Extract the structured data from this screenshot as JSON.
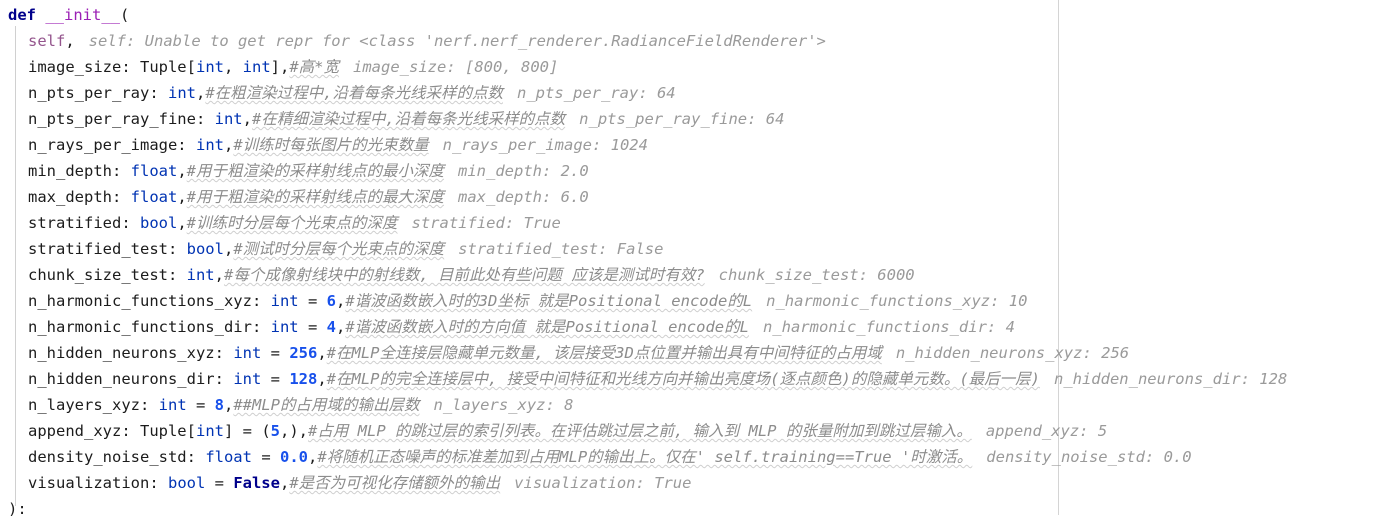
{
  "editor": {
    "language": "python",
    "colors": {
      "background": "#ffffff",
      "keyword": "#00008b",
      "function": "#9b20b5",
      "self": "#94558d",
      "type": "#0033b3",
      "number": "#1750eb",
      "comment": "#8c8c8c",
      "inline_hint": "#9a9a9a",
      "indent_guide": "#d0d0d0",
      "margin_guide": "#d4d4d4",
      "spellcheck_wave": "#cfcfcf"
    }
  },
  "code": {
    "lines": [
      {
        "id": "line-def",
        "indent": 0,
        "tokens": [
          {
            "type": "kw",
            "text": "def"
          },
          {
            "type": "plain",
            "text": " "
          },
          {
            "type": "fn",
            "text": "__init__"
          },
          {
            "type": "punct",
            "text": "("
          }
        ],
        "comment": "",
        "hint": ""
      },
      {
        "id": "line-self",
        "indent": 1,
        "tokens": [
          {
            "type": "self",
            "text": "self"
          },
          {
            "type": "punct",
            "text": ","
          }
        ],
        "comment": "",
        "hint": "self: Unable to get repr for <class 'nerf.nerf_renderer.RadianceFieldRenderer'>"
      },
      {
        "id": "line-image-size",
        "indent": 1,
        "tokens": [
          {
            "type": "plain",
            "text": "image_size: "
          },
          {
            "type": "plain",
            "text": "Tuple"
          },
          {
            "type": "punct",
            "text": "["
          },
          {
            "type": "type",
            "text": "int"
          },
          {
            "type": "punct",
            "text": ", "
          },
          {
            "type": "type",
            "text": "int"
          },
          {
            "type": "punct",
            "text": "],"
          }
        ],
        "comment": "#高*宽",
        "hint": "image_size: [800, 800]"
      },
      {
        "id": "line-n-pts-per-ray",
        "indent": 1,
        "tokens": [
          {
            "type": "plain",
            "text": "n_pts_per_ray: "
          },
          {
            "type": "type",
            "text": "int"
          },
          {
            "type": "punct",
            "text": ","
          }
        ],
        "comment": "#在粗渲染过程中,沿着每条光线采样的点数",
        "hint": "n_pts_per_ray: 64"
      },
      {
        "id": "line-n-pts-per-ray-fine",
        "indent": 1,
        "tokens": [
          {
            "type": "plain",
            "text": "n_pts_per_ray_fine: "
          },
          {
            "type": "type",
            "text": "int"
          },
          {
            "type": "punct",
            "text": ","
          }
        ],
        "comment": "#在精细渲染过程中,沿着每条光线采样的点数",
        "hint": "n_pts_per_ray_fine: 64"
      },
      {
        "id": "line-n-rays-per-image",
        "indent": 1,
        "tokens": [
          {
            "type": "plain",
            "text": "n_rays_per_image: "
          },
          {
            "type": "type",
            "text": "int"
          },
          {
            "type": "punct",
            "text": ","
          }
        ],
        "comment": "#训练时每张图片的光束数量",
        "hint": "n_rays_per_image: 1024"
      },
      {
        "id": "line-min-depth",
        "indent": 1,
        "tokens": [
          {
            "type": "plain",
            "text": "min_depth: "
          },
          {
            "type": "type",
            "text": "float"
          },
          {
            "type": "punct",
            "text": ","
          }
        ],
        "comment": "#用于粗渲染的采样射线点的最小深度",
        "hint": "min_depth: 2.0"
      },
      {
        "id": "line-max-depth",
        "indent": 1,
        "tokens": [
          {
            "type": "plain",
            "text": "max_depth: "
          },
          {
            "type": "type",
            "text": "float"
          },
          {
            "type": "punct",
            "text": ","
          }
        ],
        "comment": "#用于粗渲染的采样射线点的最大深度",
        "hint": "max_depth: 6.0"
      },
      {
        "id": "line-stratified",
        "indent": 1,
        "tokens": [
          {
            "type": "plain",
            "text": "stratified: "
          },
          {
            "type": "type",
            "text": "bool"
          },
          {
            "type": "punct",
            "text": ","
          }
        ],
        "comment": "#训练时分层每个光束点的深度",
        "hint": "stratified: True"
      },
      {
        "id": "line-stratified-test",
        "indent": 1,
        "tokens": [
          {
            "type": "plain",
            "text": "stratified_test: "
          },
          {
            "type": "type",
            "text": "bool"
          },
          {
            "type": "punct",
            "text": ","
          }
        ],
        "comment": "#测试时分层每个光束点的深度",
        "hint": "stratified_test: False"
      },
      {
        "id": "line-chunk-size-test",
        "indent": 1,
        "tokens": [
          {
            "type": "plain",
            "text": "chunk_size_test: "
          },
          {
            "type": "type",
            "text": "int"
          },
          {
            "type": "punct",
            "text": ","
          }
        ],
        "comment": "#每个成像射线块中的射线数, 目前此处有些问题 应该是测试时有效?",
        "hint": "chunk_size_test: 6000"
      },
      {
        "id": "line-n-harmonic-xyz",
        "indent": 1,
        "tokens": [
          {
            "type": "plain",
            "text": "n_harmonic_functions_xyz: "
          },
          {
            "type": "type",
            "text": "int"
          },
          {
            "type": "punct",
            "text": " = "
          },
          {
            "type": "num",
            "text": "6"
          },
          {
            "type": "punct",
            "text": ","
          }
        ],
        "comment": "#谐波函数嵌入时的3D坐标 就是Positional encode的L",
        "hint": "n_harmonic_functions_xyz: 10"
      },
      {
        "id": "line-n-harmonic-dir",
        "indent": 1,
        "tokens": [
          {
            "type": "plain",
            "text": "n_harmonic_functions_dir: "
          },
          {
            "type": "type",
            "text": "int"
          },
          {
            "type": "punct",
            "text": " = "
          },
          {
            "type": "num",
            "text": "4"
          },
          {
            "type": "punct",
            "text": ","
          }
        ],
        "comment": "#谐波函数嵌入时的方向值 就是Positional encode的L",
        "hint": "n_harmonic_functions_dir: 4"
      },
      {
        "id": "line-n-hidden-xyz",
        "indent": 1,
        "tokens": [
          {
            "type": "plain",
            "text": "n_hidden_neurons_xyz: "
          },
          {
            "type": "type",
            "text": "int"
          },
          {
            "type": "punct",
            "text": " = "
          },
          {
            "type": "num",
            "text": "256"
          },
          {
            "type": "punct",
            "text": ","
          }
        ],
        "comment": "#在MLP全连接层隐藏单元数量, 该层接受3D点位置并输出具有中间特征的占用域",
        "hint": "n_hidden_neurons_xyz: 256"
      },
      {
        "id": "line-n-hidden-dir",
        "indent": 1,
        "tokens": [
          {
            "type": "plain",
            "text": "n_hidden_neurons_dir: "
          },
          {
            "type": "type",
            "text": "int"
          },
          {
            "type": "punct",
            "text": " = "
          },
          {
            "type": "num",
            "text": "128"
          },
          {
            "type": "punct",
            "text": ","
          }
        ],
        "comment": "#在MLP的完全连接层中, 接受中间特征和光线方向并输出亮度场(逐点颜色)的隐藏单元数。(最后一层)",
        "hint": "n_hidden_neurons_dir: 128"
      },
      {
        "id": "line-n-layers-xyz",
        "indent": 1,
        "tokens": [
          {
            "type": "plain",
            "text": "n_layers_xyz: "
          },
          {
            "type": "type",
            "text": "int"
          },
          {
            "type": "punct",
            "text": " = "
          },
          {
            "type": "num",
            "text": "8"
          },
          {
            "type": "punct",
            "text": ","
          }
        ],
        "comment": "##MLP的占用域的输出层数",
        "hint": "n_layers_xyz: 8"
      },
      {
        "id": "line-append-xyz",
        "indent": 1,
        "tokens": [
          {
            "type": "plain",
            "text": "append_xyz: "
          },
          {
            "type": "plain",
            "text": "Tuple"
          },
          {
            "type": "punct",
            "text": "["
          },
          {
            "type": "type",
            "text": "int"
          },
          {
            "type": "punct",
            "text": "] = ("
          },
          {
            "type": "num",
            "text": "5"
          },
          {
            "type": "punct",
            "text": ",),"
          }
        ],
        "comment": "#占用 MLP 的跳过层的索引列表。在评估跳过层之前, 输入到 MLP 的张量附加到跳过层输入。",
        "hint": "append_xyz: 5"
      },
      {
        "id": "line-density-noise-std",
        "indent": 1,
        "tokens": [
          {
            "type": "plain",
            "text": "density_noise_std: "
          },
          {
            "type": "type",
            "text": "float"
          },
          {
            "type": "punct",
            "text": " = "
          },
          {
            "type": "num",
            "text": "0.0"
          },
          {
            "type": "punct",
            "text": ","
          }
        ],
        "comment": "#将随机正态噪声的标准差加到占用MLP的输出上。仅在' self.training==True '时激活。",
        "hint": "density_noise_std: 0.0"
      },
      {
        "id": "line-visualization",
        "indent": 1,
        "tokens": [
          {
            "type": "plain",
            "text": "visualization: "
          },
          {
            "type": "type",
            "text": "bool"
          },
          {
            "type": "punct",
            "text": " = "
          },
          {
            "type": "const",
            "text": "False"
          },
          {
            "type": "punct",
            "text": ","
          }
        ],
        "comment": "#是否为可视化存储额外的输出",
        "hint": "visualization: True"
      },
      {
        "id": "line-close",
        "indent": 0,
        "tokens": [
          {
            "type": "punct",
            "text": "):"
          }
        ],
        "comment": "",
        "hint": ""
      }
    ]
  }
}
